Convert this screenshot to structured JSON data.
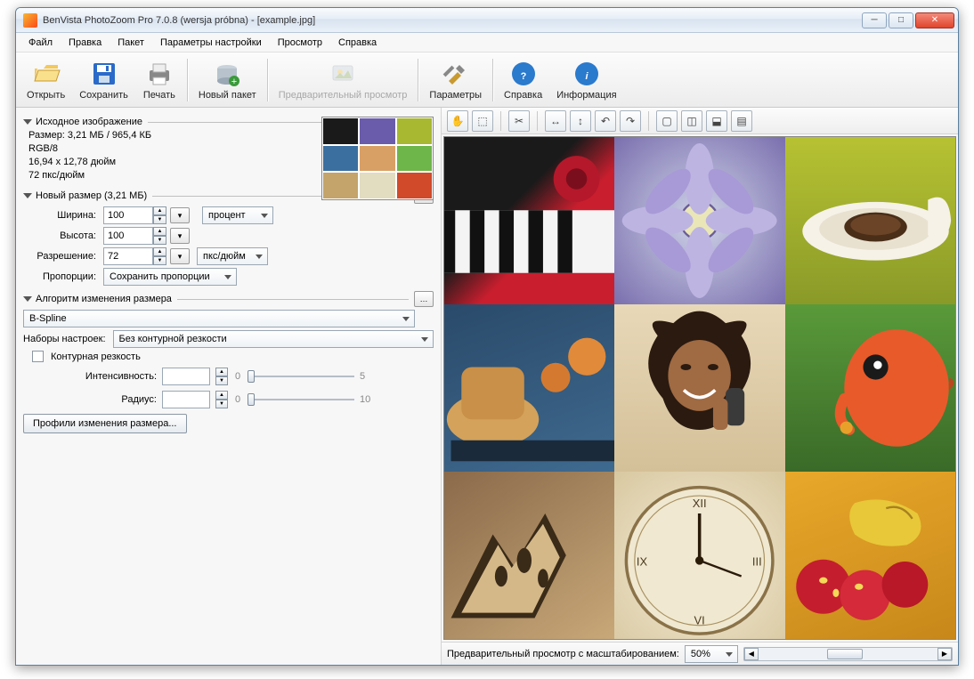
{
  "window": {
    "title": "BenVista PhotoZoom Pro 7.0.8 (wersja próbna) - [example.jpg]"
  },
  "menu": {
    "file": "Файл",
    "edit": "Правка",
    "batch": "Пакет",
    "settings": "Параметры настройки",
    "view": "Просмотр",
    "help": "Справка"
  },
  "toolbar": {
    "open": "Открыть",
    "save": "Сохранить",
    "print": "Печать",
    "newbatch": "Новый пакет",
    "preview": "Предварительный просмотр",
    "params": "Параметры",
    "helpbtn": "Справка",
    "info": "Информация"
  },
  "source": {
    "header": "Исходное изображение",
    "size": "Размер: 3,21 МБ / 965,4 КБ",
    "mode": "RGB/8",
    "dims": "16,94 x 12,78 дюйм",
    "res": "72 пкс/дюйм"
  },
  "newsize": {
    "header": "Новый размер (3,21 МБ)",
    "width_lbl": "Ширина:",
    "width_val": "100",
    "height_lbl": "Высота:",
    "height_val": "100",
    "unit": "процент",
    "res_lbl": "Разрешение:",
    "res_val": "72",
    "res_unit": "пкс/дюйм",
    "aspect_lbl": "Пропорции:",
    "aspect_val": "Сохранить пропорции"
  },
  "algo": {
    "header": "Алгоритм изменения размера",
    "method": "B-Spline",
    "presets_lbl": "Наборы настроек:",
    "presets_val": "Без контурной резкости",
    "unsharp_chk": "Контурная резкость",
    "intensity_lbl": "Интенсивность:",
    "intensity_max": "5",
    "radius_lbl": "Радиус:",
    "radius_max": "10",
    "profiles_btn": "Профили изменения размера..."
  },
  "preview_bar": {
    "label": "Предварительный просмотр с масштабированием:",
    "zoom": "50%"
  },
  "thumb_colors": [
    "#1a1a1a",
    "#6b5cab",
    "#a8b830",
    "#3b6fa0",
    "#d9a066",
    "#6eb54a",
    "#c4a46a",
    "#e2dcc0",
    "#d14a2a"
  ],
  "grid_defs": [
    {
      "bg": "linear-gradient(135deg,#1a1a1a 40%,#c91e2e 60%)",
      "svg": "<rect x='10' y='70' width='180' height='60' fill='#f4f4f4'/><rect x='10' y='70' width='14' height='60' fill='#111'/><rect x='38' y='70' width='14' height='60' fill='#111'/><rect x='66' y='70' width='14' height='60' fill='#111'/><rect x='94' y='70' width='14' height='60' fill='#111'/><rect x='122' y='70' width='14' height='60' fill='#111'/><circle cx='140' cy='40' r='22' fill='#b5182a'/><circle cx='140' cy='40' r='10' fill='#7a0e1c'/>"
    },
    {
      "bg": "radial-gradient(circle at 50% 50%,#cfd4e8,#7a6fae)",
      "svg": "<circle cx='95' cy='80' r='18' fill='#eae6b8' stroke='#6a5d99' stroke-width='2'/><ellipse cx='95' cy='40' rx='14' ry='34' fill='#bdb4e2'/><ellipse cx='95' cy='120' rx='14' ry='34' fill='#bdb4e2'/><ellipse cx='55' cy='80' rx='34' ry='14' fill='#bdb4e2'/><ellipse cx='135' cy='80' rx='34' ry='14' fill='#bdb4e2'/><ellipse cx='65' cy='52' rx='28' ry='12' fill='#a89ad6' transform='rotate(-45 65 52)'/><ellipse cx='125' cy='108' rx='28' ry='12' fill='#a89ad6' transform='rotate(-45 125 108)'/><ellipse cx='125' cy='52' rx='28' ry='12' fill='#a89ad6' transform='rotate(45 125 52)'/><ellipse cx='65' cy='108' rx='28' ry='12' fill='#a89ad6' transform='rotate(45 65 108)'/>"
    },
    {
      "bg": "linear-gradient(180deg,#b7c232,#8a9a28)",
      "svg": "<ellipse cx='100' cy='90' rx='70' ry='28' fill='#f6f2e8'/><ellipse cx='100' cy='88' rx='54' ry='20' fill='#e8e1d0'/><ellipse cx='100' cy='86' rx='30' ry='14' fill='#4a2e18'/><ellipse cx='100' cy='84' rx='24' ry='10' fill='#6b4428'/><path d='M150 60 Q170 50 172 80 Q170 100 150 94' fill='#f6f2e8'/>"
    },
    {
      "bg": "linear-gradient(160deg,#2a4a6a,#3f6a8f)",
      "svg": "<ellipse cx='60' cy='110' rx='44' ry='26' fill='#d4a25a'/><rect x='30' y='60' width='60' height='50' rx='10' fill='#c89048'/><circle cx='150' cy='50' r='18' fill='#e08a3a'/><circle cx='120' cy='70' r='14' fill='#d47a30'/><rect x='20' y='130' width='160' height='20' fill='#1a2a3a'/>"
    },
    {
      "bg": "linear-gradient(180deg,#e8d8b8,#d4c098)",
      "svg": "<ellipse cx='95' cy='60' rx='38' ry='44' fill='#8a5a3a'/><path d='M55 30 Q40 10 70 18 Q95 -5 120 18 Q150 10 135 30 Q155 60 130 90 Q120 120 95 120 Q70 120 60 90 Q35 60 55 30' fill='#2a1a10'/><ellipse cx='95' cy='68' rx='30' ry='34' fill='#a06a42'/><ellipse cx='82' cy='60' rx='5' ry='3' fill='#2a1a10'/><ellipse cx='108' cy='60' rx='5' ry='3' fill='#2a1a10'/><path d='M80 82 Q95 96 110 82' stroke='#fff' stroke-width='3' fill='none'/><rect x='120' y='80' width='18' height='36' rx='6' fill='#3a3a3a'/><rect x='108' y='90' width='14' height='30' rx='5' fill='#a06a42'/>"
    },
    {
      "bg": "linear-gradient(180deg,#5a9a3a,#3a6a28)",
      "svg": "<ellipse cx='120' cy='80' rx='50' ry='56' fill='#e85a2a'/><circle cx='100' cy='60' r='12' fill='#1a1a1a'/><circle cx='102' cy='58' r='4' fill='#fff'/><path d='M70 90 Q60 110 75 120' stroke='#e85a2a' stroke-width='10' fill='none' stroke-linecap='round'/><circle cx='72' cy='118' r='6' fill='#e8a02a'/><path d='M170 70 Q180 74 170 82' fill='#b84820'/>"
    },
    {
      "bg": "linear-gradient(145deg,#8a6a4a,#c8a878)",
      "svg": "<path d='M20 140 L60 60 L80 90 L110 40 L130 80 L100 140 Z' fill='#3a2a18'/><path d='M30 135 L65 70 L78 92 L108 50 L124 82 L98 135 Z' fill='#d4b888'/><ellipse cx='68' cy='100' rx='6' ry='10' fill='#3a2a18'/><ellipse cx='90' cy='85' rx='7' ry='12' fill='#3a2a18'/><ellipse cx='108' cy='102' rx='5' ry='9' fill='#3a2a18'/>"
    },
    {
      "bg": "radial-gradient(circle at 50% 55%,#f4ecd8,#d8c8a0)",
      "svg": "<circle cx='95' cy='85' r='70' fill='#f0e8d0' stroke='#8a7248' stroke-width='3'/><circle cx='95' cy='85' r='62' fill='none' stroke='#a89060' stroke-width='1'/><text x='95' y='34' font-size='12' text-anchor='middle' fill='#4a3a20' font-family='serif'>XII</text><text x='150' y='90' font-size='12' text-anchor='middle' fill='#4a3a20' font-family='serif'>III</text><text x='95' y='146' font-size='12' text-anchor='middle' fill='#4a3a20' font-family='serif'>VI</text><text x='40' y='90' font-size='12' text-anchor='middle' fill='#4a3a20' font-family='serif'>IX</text><line x1='95' y1='85' x2='95' y2='40' stroke='#2a1a08' stroke-width='3'/><line x1='95' y1='85' x2='135' y2='100' stroke='#2a1a08' stroke-width='2'/><circle cx='95' cy='85' r='4' fill='#2a1a08'/>"
    },
    {
      "bg": "linear-gradient(160deg,#e8a82a,#c8881a)",
      "svg": "<circle cx='50' cy='110' r='26' fill='#c41e2e'/><circle cx='90' cy='118' r='24' fill='#d42a3a'/><circle cx='128' cy='108' r='22' fill='#b81828'/><ellipse cx='50' cy='104' rx='4' ry='3' fill='#f4d858'/><ellipse cx='62' cy='116' rx='3' ry='4' fill='#f4d858'/><ellipse cx='84' cy='110' rx='4' ry='3' fill='#f4d858'/><path d='M80 30 Q110 20 140 40 Q150 60 130 70 Q100 75 80 60 Q70 40 80 30' fill='#e8c838'/><path d='M110 35 Q125 30 135 45' stroke='#a88020' stroke-width='2' fill='none'/>"
    }
  ]
}
